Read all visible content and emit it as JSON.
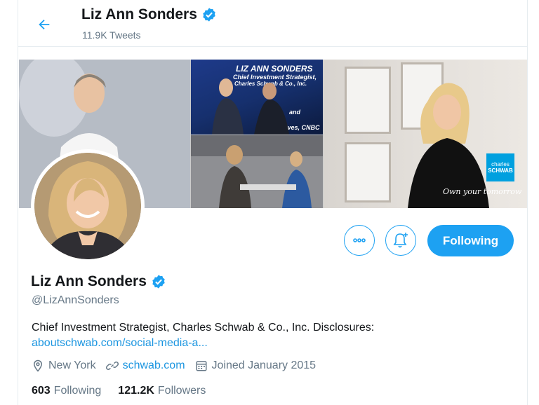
{
  "header": {
    "name": "Liz Ann Sonders",
    "tweets_count": "11.9K Tweets"
  },
  "banner": {
    "panel_text_line1": "LIZ ANN SONDERS",
    "panel_text_line2": "Chief Investment Strategist,",
    "panel_text_line3": "Charles Schwab & Co., Inc.",
    "panel_text_line4": "and",
    "panel_text_line5": "tives, CNBC",
    "logo_line1": "charles",
    "logo_line2": "SCHWAB",
    "tagline": "Own your tomorrow"
  },
  "actions": {
    "more_icon": "more-icon",
    "bell_icon": "bell-plus-icon",
    "follow_label": "Following"
  },
  "profile": {
    "name": "Liz Ann Sonders",
    "handle": "@LizAnnSonders",
    "bio_text": "Chief Investment Strategist, Charles Schwab & Co., Inc. Disclosures:",
    "bio_link": "aboutschwab.com/social-media-a...",
    "location": "New York",
    "website": "schwab.com",
    "joined": "Joined January 2015",
    "following_count": "603",
    "following_label": "Following",
    "followers_count": "121.2K",
    "followers_label": "Followers"
  },
  "colors": {
    "accent": "#1da1f2",
    "link": "#1b95e0",
    "muted": "#657786",
    "text": "#14171a"
  }
}
